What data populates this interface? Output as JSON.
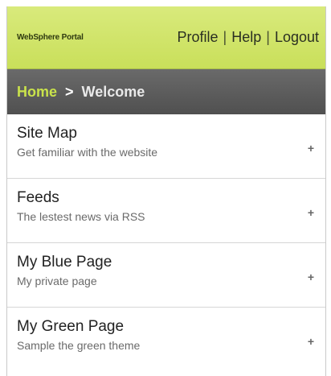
{
  "header": {
    "brand": "WebSphere Portal",
    "nav": {
      "profile": "Profile",
      "help": "Help",
      "logout": "Logout",
      "separator": "|"
    }
  },
  "breadcrumb": {
    "home": "Home",
    "arrow": ">",
    "current": "Welcome"
  },
  "items": [
    {
      "title": "Site Map",
      "subtitle": "Get familiar with the website",
      "icon": "plus-icon",
      "glyph": "+"
    },
    {
      "title": "Feeds",
      "subtitle": "The lestest news via RSS",
      "icon": "plus-icon",
      "glyph": "+"
    },
    {
      "title": "My Blue Page",
      "subtitle": "My private page",
      "icon": "plus-icon",
      "glyph": "+"
    },
    {
      "title": "My Green Page",
      "subtitle": "Sample the green theme",
      "icon": "plus-icon",
      "glyph": "+"
    }
  ],
  "colors": {
    "header_bg": "#d2e46c",
    "breadcrumb_bg": "#5a5a5a",
    "breadcrumb_home": "#c9e24b"
  }
}
